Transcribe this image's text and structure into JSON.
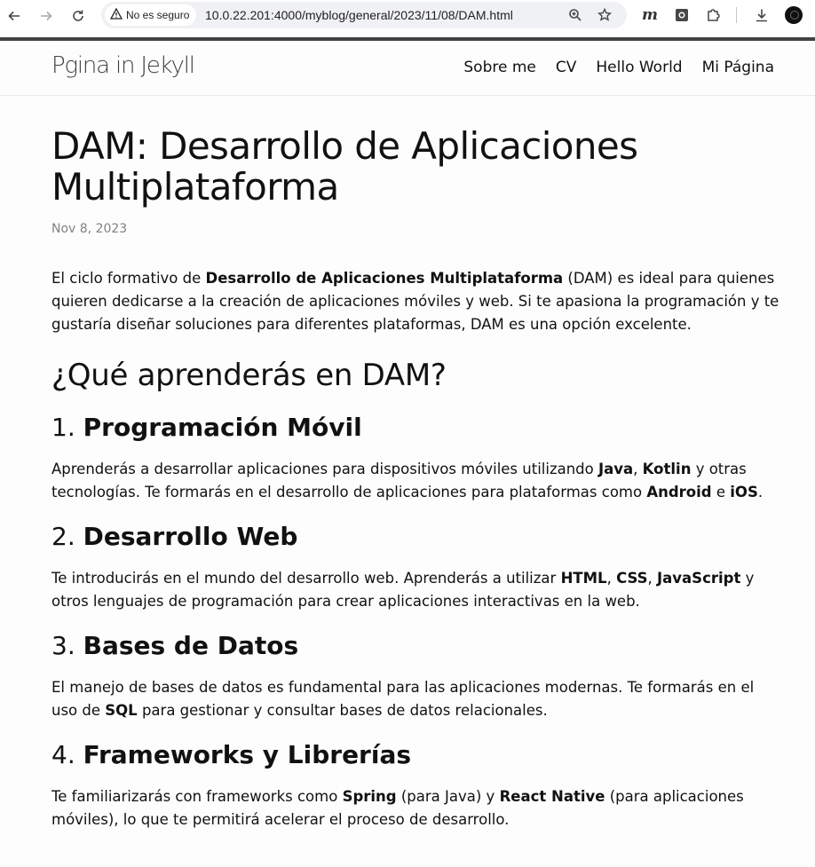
{
  "browser": {
    "security_label": "No es seguro",
    "url": "10.0.22.201:4000/myblog/general/2023/11/08/DAM.html",
    "extension_m_label": "m"
  },
  "site": {
    "title": "Pgina in Jekyll",
    "nav": [
      "Sobre me",
      "CV",
      "Hello World",
      "Mi Página"
    ]
  },
  "post": {
    "title": "DAM: Desarrollo de Aplicaciones Multiplataforma",
    "date": "Nov 8, 2023",
    "intro": {
      "t1": "El ciclo formativo de ",
      "b1": "Desarrollo de Aplicaciones Multiplataforma",
      "t2": " (DAM) es ideal para quienes quieren dedicarse a la creación de aplicaciones móviles y web. Si te apasiona la programación y te gustaría diseñar soluciones para diferentes plataformas, DAM es una opción excelente."
    },
    "section_heading": "¿Qué aprenderás en DAM?",
    "sections": [
      {
        "number": "1.",
        "title": "Programación Móvil",
        "t1": "Aprenderás a desarrollar aplicaciones para dispositivos móviles utilizando ",
        "b1": "Java",
        "t2": ", ",
        "b2": "Kotlin",
        "t3": " y otras tecnologías. Te formarás en el desarrollo de aplicaciones para plataformas como ",
        "b3": "Android",
        "t4": " e ",
        "b4": "iOS",
        "t5": "."
      },
      {
        "number": "2.",
        "title": "Desarrollo Web",
        "t1": "Te introducirás en el mundo del desarrollo web. Aprenderás a utilizar ",
        "b1": "HTML",
        "t2": ", ",
        "b2": "CSS",
        "t3": ", ",
        "b3": "JavaScript",
        "t4": " y otros lenguajes de programación para crear aplicaciones interactivas en la web."
      },
      {
        "number": "3.",
        "title": "Bases de Datos",
        "t1": "El manejo de bases de datos es fundamental para las aplicaciones modernas. Te formarás en el uso de ",
        "b1": "SQL",
        "t2": " para gestionar y consultar bases de datos relacionales."
      },
      {
        "number": "4.",
        "title": "Frameworks y Librerías",
        "t1": "Te familiarizarás con frameworks como ",
        "b1": "Spring",
        "t2": " (para Java) y ",
        "b2": "React Native",
        "t3": " (para aplicaciones móviles), lo que te permitirá acelerar el proceso de desarrollo."
      }
    ]
  }
}
